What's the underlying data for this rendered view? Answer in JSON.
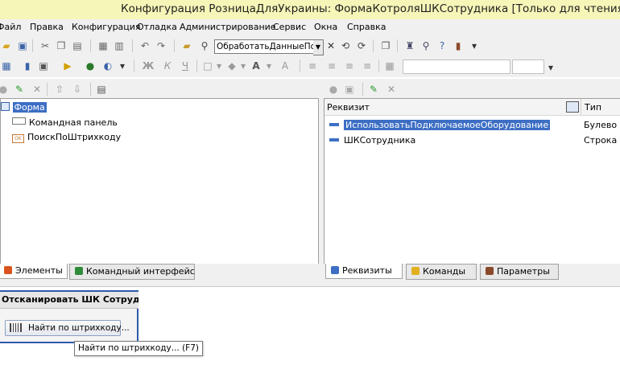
{
  "window": {
    "title": "Конфигурация РозницаДляУкраины: ФормаКотроляШКСотрудника [Только для чтения]"
  },
  "menu": {
    "items": [
      "Файл",
      "Правка",
      "Конфигурация",
      "Отладка",
      "Администрирование",
      "Сервис",
      "Окна",
      "Справка"
    ]
  },
  "toolbar": {
    "search_value": "ОбработатьДанныеПо"
  },
  "elements_panel": {
    "tree": [
      {
        "label": "Форма",
        "selected": true
      },
      {
        "label": "Командная панель"
      },
      {
        "label": "ПоискПоШтрихкоду"
      }
    ],
    "tabs": [
      "Элементы",
      "Командный интерфейс"
    ]
  },
  "requisites_panel": {
    "columns": [
      "Реквизит",
      "Тип"
    ],
    "rows": [
      {
        "name": "ИспользоватьПодключаемоеОборудование",
        "type": "Булево",
        "selected": true
      },
      {
        "name": "ШКСотрудника",
        "type": "Строка"
      }
    ],
    "tabs": [
      "Реквизиты",
      "Команды",
      "Параметры"
    ]
  },
  "preview": {
    "header": "Отсканировать ШК Сотрудни",
    "button": "Найти по штрихкоду...",
    "tooltip": "Найти по штрихкоду... (F7)"
  },
  "colors": {
    "title_bg": "#f6f6b8",
    "selection": "#3d6ec4",
    "accent_orange": "#d9541e"
  }
}
